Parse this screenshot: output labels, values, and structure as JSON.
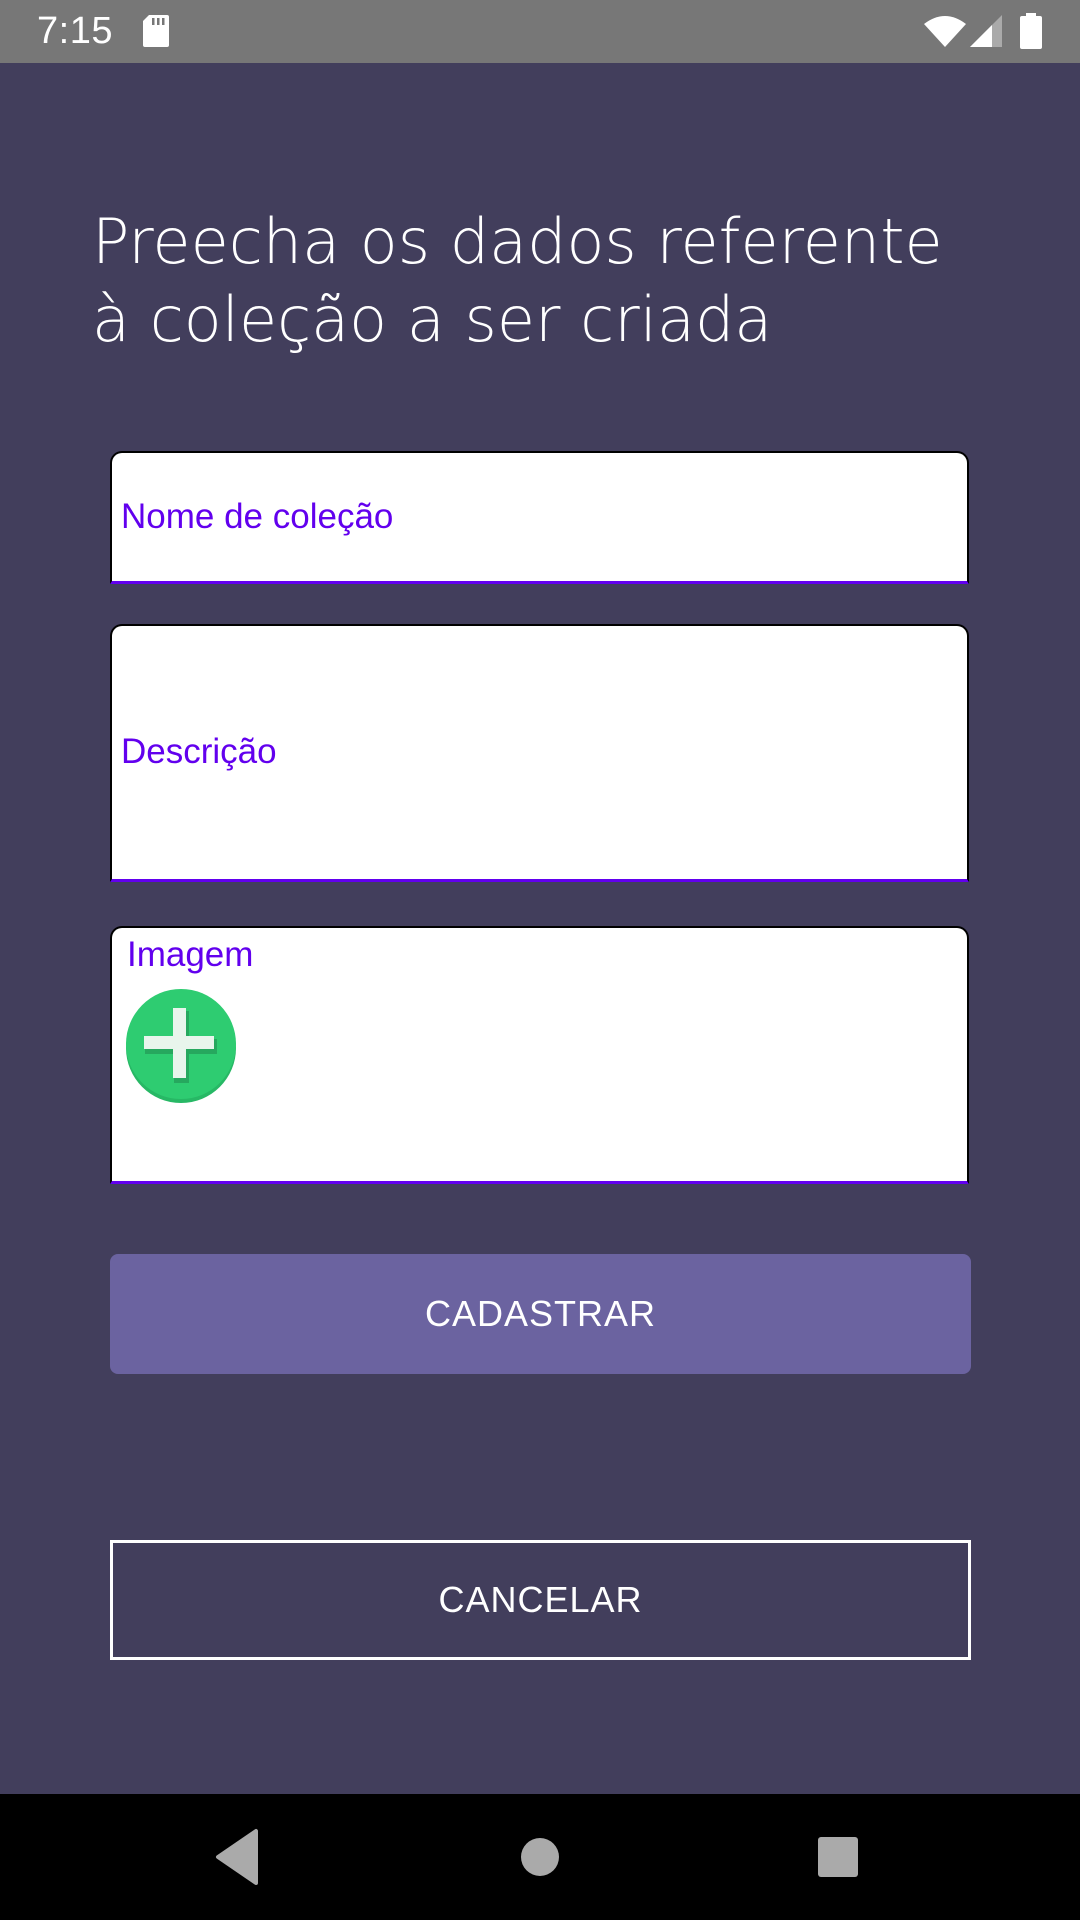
{
  "status_bar": {
    "time": "7:15",
    "icons": [
      "sd-card-icon",
      "wifi-icon",
      "cell-signal-icon",
      "battery-icon"
    ]
  },
  "form": {
    "title": "Preecha os dados referente à coleção a ser criada",
    "name_field": {
      "label": "Nome de coleção",
      "value": ""
    },
    "description_field": {
      "label": "Descrição",
      "value": ""
    },
    "image_field": {
      "label": "Imagem",
      "add_icon": "add-circle-icon"
    },
    "submit_label": "CADASTRAR",
    "cancel_label": "CANCELAR"
  },
  "nav_bar": {
    "buttons": [
      "back-icon",
      "home-icon",
      "recents-icon"
    ]
  },
  "colors": {
    "background": "#423e5c",
    "status_bar": "#777777",
    "accent": "#6200ee",
    "submit_button": "#6b63a0",
    "add_icon": "#2ecc71",
    "nav_bar": "#000000"
  }
}
